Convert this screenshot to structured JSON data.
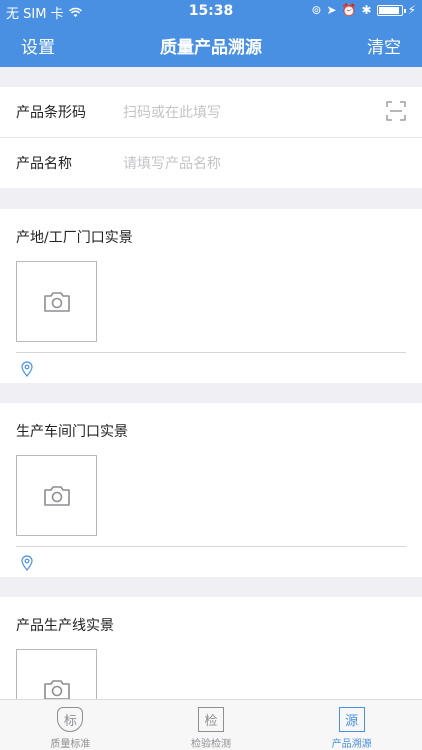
{
  "status_bar": {
    "carrier": "无 SIM 卡",
    "time": "15:38"
  },
  "nav": {
    "left": "设置",
    "title": "质量产品溯源",
    "right": "清空"
  },
  "form": {
    "barcode_label": "产品条形码",
    "barcode_placeholder": "扫码或在此填写",
    "name_label": "产品名称",
    "name_placeholder": "请填写产品名称"
  },
  "sections": [
    {
      "title": "产地/工厂门口实景"
    },
    {
      "title": "生产车间门口实景"
    },
    {
      "title": "产品生产线实景"
    }
  ],
  "tabs": [
    {
      "icon_text": "标",
      "label": "质量标准",
      "icon": "shield-icon"
    },
    {
      "icon_text": "检",
      "label": "检验检测",
      "icon": "inspect-icon"
    },
    {
      "icon_text": "源",
      "label": "产品溯源",
      "icon": "trace-icon"
    }
  ],
  "colors": {
    "accent": "#4a90e2",
    "background": "#efeff4"
  }
}
